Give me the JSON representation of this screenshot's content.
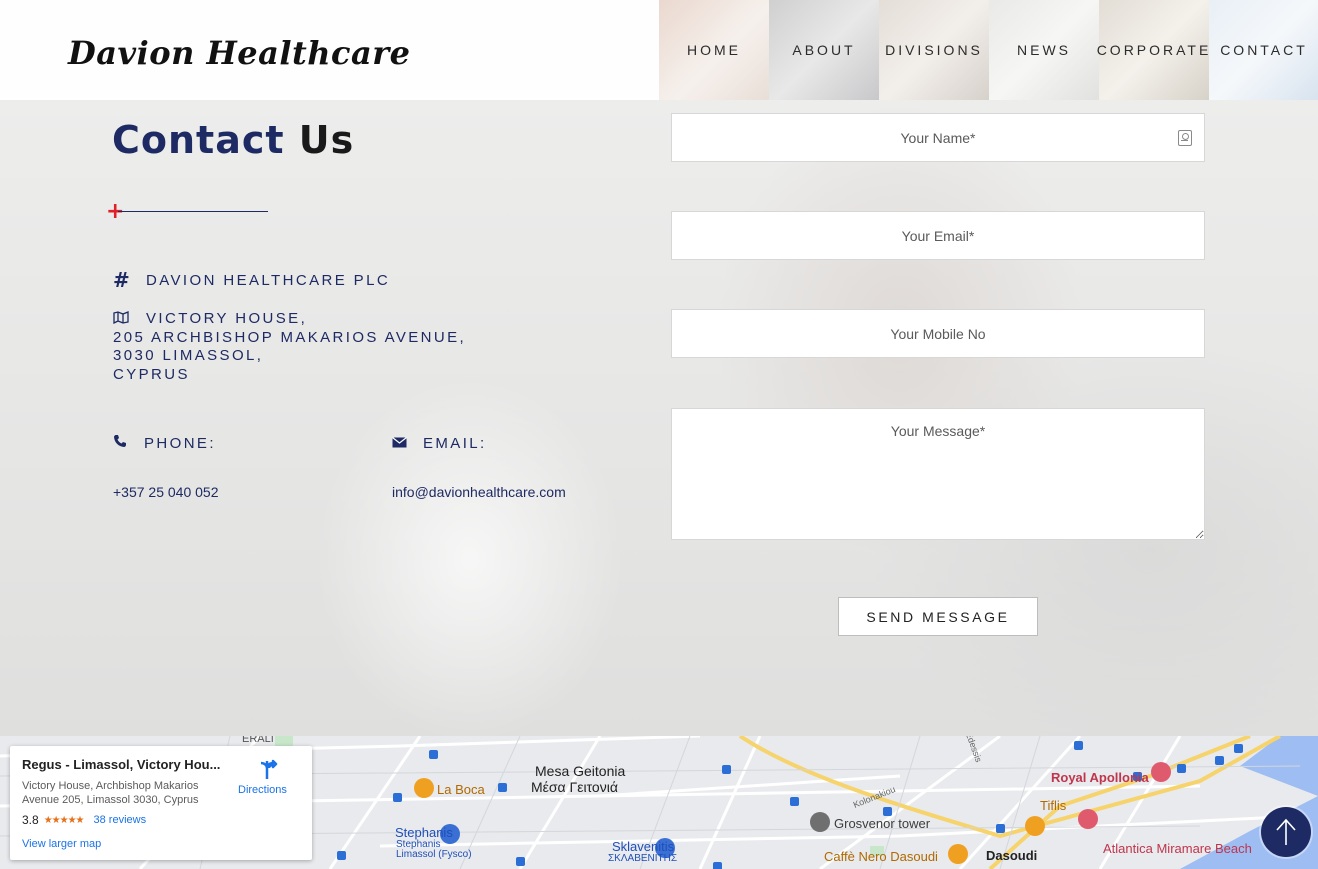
{
  "header": {
    "logo": "Davion Healthcare",
    "nav": [
      "HOME",
      "ABOUT",
      "DIVISIONS",
      "NEWS",
      "CORPORATE",
      "CONTACT"
    ]
  },
  "contact": {
    "title_part1": "Contact",
    "title_part2": "Us",
    "company": "DAVION HEALTHCARE PLC",
    "address_lines": [
      "VICTORY HOUSE,",
      "205 ARCHBISHOP MAKARIOS AVENUE,",
      "3030 LIMASSOL,",
      "CYPRUS"
    ],
    "phone_label": "PHONE:",
    "phone_value": "+357 25 040 052",
    "email_label": "EMAIL:",
    "email_value": "info@davionhealthcare.com"
  },
  "form": {
    "name_placeholder": "Your Name*",
    "email_placeholder": "Your Email*",
    "mobile_placeholder": "Your Mobile No",
    "message_placeholder": "Your Message*",
    "send_label": "SEND MESSAGE"
  },
  "map": {
    "place_title": "Regus - Limassol, Victory Hou...",
    "place_address": "Victory House, Archbishop Makarios Avenue 205, Limassol 3030, Cyprus",
    "rating": "3.8",
    "stars": "★★★★★",
    "reviews": "38 reviews",
    "view_larger": "View larger map",
    "directions": "Directions",
    "labels": {
      "mesa_geitonia": "Mesa Geitonia",
      "mesa_geitonia_gr": "Μέσα Γειτονιά",
      "la_boca": "La Boca",
      "stephanis": "Stephanis",
      "stephanis_sub": "Stephanis\nLimassol (Fysco)",
      "sklavenitis": "Sklavenitis",
      "sklavenitis_gr": "ΣΚΛΑΒΕΝΙΤΗΣ",
      "grosvenor": "Grosvenor tower",
      "caffe_nero": "Caffè Nero Dasoudi",
      "dasoudi": "Dasoudi",
      "royal_apollonia": "Royal Apollonia",
      "tiflis": "Tiflis",
      "atlantica": "Atlantica Miramare Beach",
      "kolonakiou": "Kolonakiou",
      "edessis": "Edessis",
      "erali": "ERALI"
    }
  },
  "colors": {
    "navy": "#1e2a63",
    "accent_red": "#e11f2a"
  }
}
